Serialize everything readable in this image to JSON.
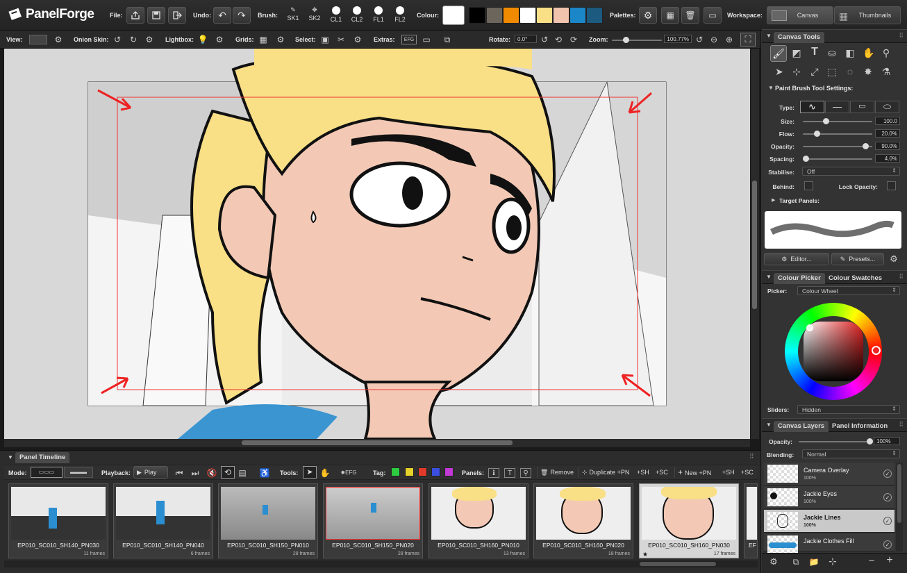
{
  "app": {
    "name": "PanelForge"
  },
  "toolbar": {
    "file_label": "File:",
    "undo_label": "Undo:",
    "brush_label": "Brush:",
    "brushes": [
      "SK1",
      "SK2",
      "CL1",
      "CL2",
      "FL1",
      "FL2"
    ],
    "colour_label": "Colour:",
    "palette_colours": [
      "#000000",
      "#6b655c",
      "#f28a00",
      "#ffffff",
      "#f9df86",
      "#f1c4ae",
      "#1b86c8",
      "#1d5a80"
    ],
    "current_colour": "#ffffff",
    "palettes_label": "Palettes:",
    "workspace_label": "Workspace:",
    "workspace_canvas": "Canvas",
    "workspace_thumbnails": "Thumbnails"
  },
  "viewbar": {
    "view": "View:",
    "onion": "Onion Skin:",
    "lightbox": "Lightbox:",
    "grids": "Grids:",
    "select": "Select:",
    "extras": "Extras:",
    "rotate": "Rotate:",
    "rotate_value": "0.0°",
    "zoom": "Zoom:",
    "zoom_value": "100.77%",
    "zoom_fraction": 0.28
  },
  "canvas_tools": {
    "title": "Canvas Tools",
    "settings_title": "Paint Brush Tool Settings:",
    "type_label": "Type:",
    "size_label": "Size:",
    "size_value": "100.0",
    "size_fraction": 0.33,
    "flow_label": "Flow:",
    "flow_value": "20.0%",
    "flow_fraction": 0.2,
    "opacity_label": "Opacity:",
    "opacity_value": "90.0%",
    "opacity_fraction": 0.9,
    "spacing_label": "Spacing:",
    "spacing_value": "4.0%",
    "spacing_fraction": 0.04,
    "stabilise_label": "Stabilise:",
    "stabilise_value": "Off",
    "behind_label": "Behind:",
    "lock_opacity_label": "Lock Opacity:",
    "target_panels_label": "Target Panels:",
    "editor_button": "Editor...",
    "presets_button": "Presets..."
  },
  "colour_panel": {
    "tab_picker": "Colour Picker",
    "tab_swatches": "Colour Swatches",
    "picker_label": "Picker:",
    "picker_value": "Colour Wheel",
    "sliders_label": "Sliders:",
    "sliders_value": "Hidden"
  },
  "layers_panel": {
    "tab_layers": "Canvas Layers",
    "tab_info": "Panel Information",
    "opacity_label": "Opacity:",
    "opacity_value": "100%",
    "opacity_fraction": 1.0,
    "blending_label": "Blending:",
    "blending_value": "Normal",
    "layers": [
      {
        "name": "Camera Overlay",
        "opacity": "100%"
      },
      {
        "name": "Jackie Eyes",
        "opacity": "100%"
      },
      {
        "name": "Jackie Lines",
        "opacity": "100%"
      },
      {
        "name": "Jackie Clothes Fill",
        "opacity": "100%"
      }
    ]
  },
  "timeline": {
    "title": "Panel Timeline",
    "mode_label": "Mode:",
    "playback_label": "Playback:",
    "play_button": "Play",
    "tools_label": "Tools:",
    "tag_label": "Tag:",
    "tag_colours": [
      "#2ecc40",
      "#e6d22a",
      "#e23a2a",
      "#3a4fe0",
      "#c23ad6"
    ],
    "panels_label": "Panels:",
    "remove_button": "Remove",
    "duplicate_button": "Duplicate",
    "new_button": "New",
    "pn": "+PN",
    "sh": "+SH",
    "sc": "+SC",
    "thumbnails": [
      {
        "name": "EP010_SC010_SH140_PN030",
        "frames": "11 frames"
      },
      {
        "name": "EP010_SC010_SH140_PN040",
        "frames": "6 frames"
      },
      {
        "name": "EP010_SC010_SH150_PN010",
        "frames": "28 frames"
      },
      {
        "name": "EP010_SC010_SH150_PN020",
        "frames": "28 frames"
      },
      {
        "name": "EP010_SC010_SH160_PN010",
        "frames": "13 frames"
      },
      {
        "name": "EP010_SC010_SH160_PN020",
        "frames": "18 frames"
      },
      {
        "name": "EP010_SC010_SH160_PN030",
        "frames": "17 frames"
      },
      {
        "name": "EF",
        "frames": ""
      }
    ]
  }
}
